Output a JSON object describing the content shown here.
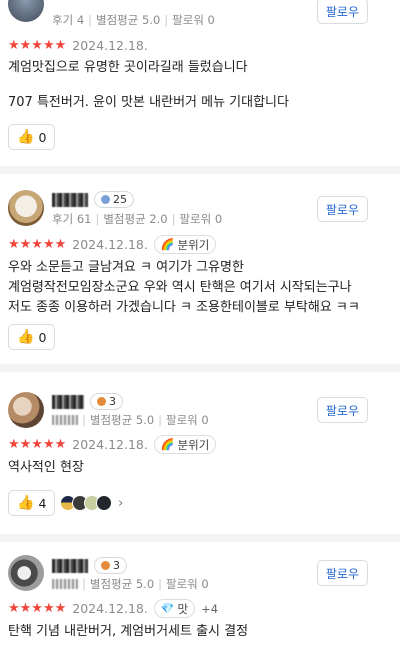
{
  "reviews": [
    {
      "id": "r1",
      "meta": {
        "reviews": "후기 4",
        "avg_label": "별점평균 5.0",
        "followers": "팔로워 0"
      },
      "follow_label": "팔로우",
      "stars": "★★★★★",
      "date": "2024.12.18.",
      "lines": [
        "계엄맛집으로 유명한 곳이라길래 들렀습니다",
        "707 특전버거. 윤이 맛본 내란버거 메뉴 기대합니다"
      ],
      "likes": "0"
    },
    {
      "id": "r2",
      "level": "25",
      "meta": {
        "reviews": "후기 61",
        "avg_label": "별점평균 2.0",
        "followers": "팔로워 0"
      },
      "follow_label": "팔로우",
      "stars": "★★★★★",
      "date": "2024.12.18.",
      "tag": "분위기",
      "lines": [
        "우와 소문듣고 글남겨요 ㅋ 여기가 그유명한",
        "계엄령작전모임장소군요 우와 역시 탄핵은 여기서 시작되는구나",
        "저도 종종 이용하러 가겠습니다 ㅋ 조용한테이블로 부탁해요 ㅋㅋ"
      ],
      "likes": "0"
    },
    {
      "id": "r3",
      "level": "3",
      "meta": {
        "avg_label": "별점평균 5.0",
        "followers": "팔로워 0"
      },
      "follow_label": "팔로우",
      "stars": "★★★★★",
      "date": "2024.12.18.",
      "tag": "분위기",
      "lines": [
        "역사적인 현장"
      ],
      "likes": "4"
    },
    {
      "id": "r4",
      "level": "3",
      "meta": {
        "avg_label": "별점평균 5.0",
        "followers": "팔로워 0"
      },
      "follow_label": "팔로우",
      "stars": "★★★★★",
      "date": "2024.12.18.",
      "tag": "맛",
      "tag_extra": "+4",
      "lines": [
        "탄핵 기념 내란버거, 계엄버거세트 출시 결정"
      ]
    }
  ],
  "colors": {
    "star": "#f0453a",
    "follow_text": "#2467d1",
    "divider": "#f2f3f5",
    "level_badge": "#7b9fd6"
  },
  "icons": {
    "like": "thumbs-up-icon",
    "tag_mood": "rainbow-icon",
    "tag_taste": "gem-icon",
    "more": "chevron-right-icon"
  }
}
